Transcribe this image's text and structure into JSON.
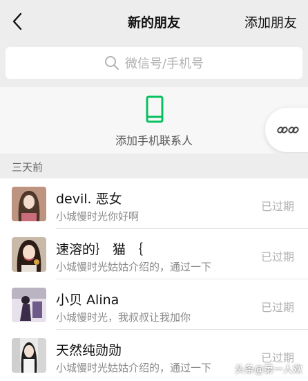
{
  "navbar": {
    "title": "新的朋友",
    "action_label": "添加朋友",
    "back_icon": "chevron-left-icon"
  },
  "search": {
    "placeholder": "微信号/手机号",
    "icon": "search-icon"
  },
  "add_contacts": {
    "label": "添加手机联系人",
    "icon": "phone-icon",
    "accent": "#07c160"
  },
  "floating_button": {
    "icon": "link-icon"
  },
  "section": {
    "label": "三天前"
  },
  "requests": [
    {
      "name": "devil. 恶女",
      "message": "小城慢时光你好啊",
      "status": "已过期"
    },
    {
      "name": "速溶的｝ 猫 ｛",
      "message": "小城慢时光姑姑介绍的，通过一下",
      "status": "已过期"
    },
    {
      "name": "小贝 Alina",
      "message": "小城慢时光，我叔叔让我加你",
      "status": "已过期"
    },
    {
      "name": "天然纯勋勋",
      "message": "小城慢时光姑姑介绍的，通过一下",
      "status": "已过期"
    }
  ],
  "watermark": "头条@第一人欢",
  "colors": {
    "background": "#ededed",
    "secondary_text": "#8a8a8a",
    "expired": "#b2b2b2"
  }
}
